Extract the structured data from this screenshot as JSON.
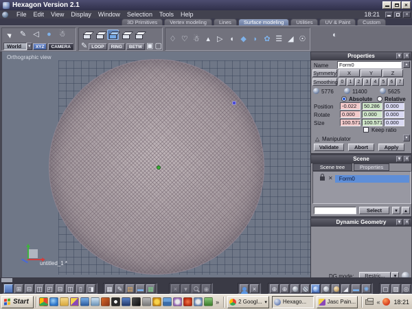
{
  "window": {
    "title": "Hexagon Version 2.1"
  },
  "menu": {
    "items": [
      "File",
      "Edit",
      "View",
      "Display",
      "Window",
      "Selection",
      "Tools",
      "Help"
    ],
    "clock": "18:21"
  },
  "tabs": {
    "items": [
      {
        "label": "3D Primitives",
        "active": false
      },
      {
        "label": "Vertex modeling",
        "active": false
      },
      {
        "label": "Lines",
        "active": false
      },
      {
        "label": "Surface modeling",
        "active": true
      },
      {
        "label": "Utilities",
        "active": false
      },
      {
        "label": "UV & Paint",
        "active": false
      },
      {
        "label": "Custom",
        "active": false
      }
    ]
  },
  "toolbar": {
    "world": "World",
    "xyz": "XYZ",
    "camera": "CAMERA",
    "loop": "LOOP",
    "ring": "RING",
    "betw": "BETW"
  },
  "viewport": {
    "label": "Orthographic view",
    "document": "untitled_1 *"
  },
  "properties": {
    "title": "Properties",
    "name_label": "Name",
    "name_value": "Form0",
    "symmetry": "Symmetry",
    "axes": [
      "X",
      "Y",
      "Z"
    ],
    "smoothing": "Smoothing",
    "levels": [
      "0",
      "1",
      "2",
      "3",
      "4",
      "5",
      "6",
      "7"
    ],
    "counts": [
      "5776",
      "11400",
      "5625"
    ],
    "absolute": "Absolute",
    "relative": "Relative",
    "rows": [
      {
        "label": "Position",
        "values": [
          "-0.022",
          "50.286",
          "0.000"
        ]
      },
      {
        "label": "Rotate",
        "values": [
          "0.000",
          "0.000",
          "0.000"
        ]
      },
      {
        "label": "Size",
        "values": [
          "100.571",
          "100.571",
          "0.000"
        ]
      }
    ],
    "keep_ratio": "Keep ratio",
    "manipulator": "Manipulator",
    "validate": "Validate",
    "abort": "Abort",
    "apply": "Apply"
  },
  "scene": {
    "title": "Scene",
    "tab_tree": "Scene tree",
    "tab_props": "Properties",
    "item": "Form0",
    "select": "Select"
  },
  "dg": {
    "title": "Dynamic Geometry",
    "mode_label": "DG mode:",
    "mode_value": "Restric..."
  },
  "taskbar": {
    "start": "Start",
    "overflow": "»",
    "chevron": "«",
    "clock": "18:21",
    "tasks": [
      {
        "label": "2 Googl..."
      },
      {
        "label": "Hexago..."
      },
      {
        "label": "Jasc Pain..."
      }
    ]
  },
  "glyphs": {
    "close": "×",
    "rollup": "▾",
    "up": "▴",
    "down": "▾",
    "tri": "△",
    "eye": "◉",
    "cross": "×",
    "pen": "✎",
    "layouts": [
      "",
      "⊞",
      "⊟",
      "◫",
      "◰",
      "⊟",
      "◫",
      "▯",
      "◨"
    ],
    "display": [
      "▦",
      "✎",
      "▤",
      "▬",
      "▦"
    ],
    "wire_sphere": "⊕"
  },
  "colors": {
    "accent": "#5e8ed8",
    "pos_x_bg": "#f2caca",
    "pos_y_bg": "#cfe6c9",
    "pos_z_bg": "#d9d9f2",
    "viewport_bg": "#6f7787",
    "sphere": "#b6aaae",
    "taskbar_bg": "#d6cec3",
    "titlebar": "#3c3c5c"
  }
}
